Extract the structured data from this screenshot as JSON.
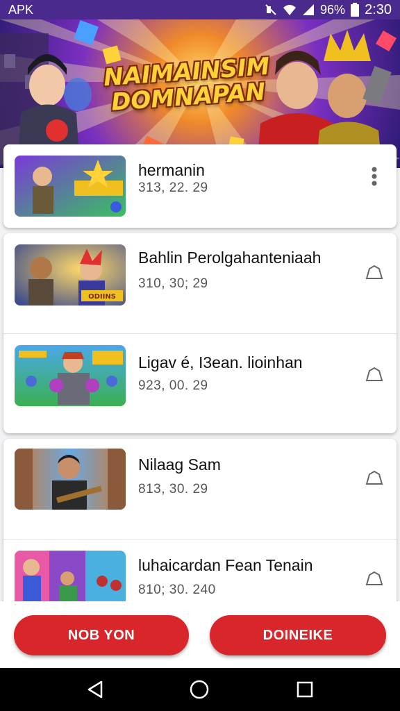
{
  "status_bar": {
    "app_label": "APK",
    "battery": "96%",
    "time": "2:30"
  },
  "banner": {
    "title_line1": "NAIMAINSIM",
    "title_line2": "DOMNAPAN"
  },
  "list": [
    {
      "title": "hermanin",
      "subtitle": "313, 22. 29",
      "action_icon": "more-vert-icon"
    },
    {
      "title": "Bahlin Perolgahanteniaah",
      "subtitle": "310, 30; 29",
      "action_icon": "home-outline-icon",
      "thumb_text": "ODIINS"
    },
    {
      "title": "Ligav é, I3ean. lioinhan",
      "subtitle": "923, 00. 29",
      "action_icon": "home-outline-icon"
    },
    {
      "title": "Nilaag Sam",
      "subtitle": "813, 30. 29",
      "action_icon": "home-outline-icon"
    },
    {
      "title": "luhaicardan Fean Tenain",
      "subtitle": "810; 30. 240",
      "action_icon": "home-outline-icon"
    }
  ],
  "buttons": {
    "left": "NOB YON",
    "right": "DOINEIKE"
  },
  "colors": {
    "status_bar": "#4a2a8c",
    "button_red": "#d9262b",
    "nav_bar": "#000000"
  }
}
